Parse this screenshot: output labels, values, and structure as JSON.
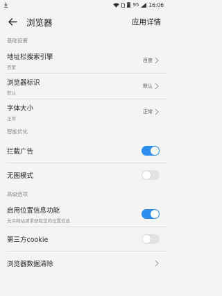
{
  "status_bar": {
    "battery_pct": "95",
    "time": "16:06"
  },
  "header": {
    "title": "浏览器",
    "action_label": "应用详情"
  },
  "sections": {
    "basic": {
      "header": "基础设置",
      "address_bar_engine": {
        "label": "地址栏搜索引擎",
        "sub": "百度",
        "value": "百度"
      },
      "browser_ua": {
        "label": "浏览器标识",
        "sub": "默认",
        "value": "默认"
      },
      "font_size": {
        "label": "字体大小",
        "sub": "正常",
        "value": "正常"
      }
    },
    "smart": {
      "header": "智能优化",
      "block_ads": {
        "label": "拦截广告",
        "enabled": true
      },
      "no_image": {
        "label": "无图模式",
        "enabled": false
      }
    },
    "advanced": {
      "header": "高级选项",
      "location": {
        "label": "启用位置信息功能",
        "sub": "允许网站请求获取您的位置信息",
        "enabled": true
      },
      "third_party_cookie": {
        "label": "第三方cookie",
        "enabled": false
      },
      "clear_data": {
        "label": "浏览器数据清除"
      }
    }
  },
  "colors": {
    "background": "#f4f4f4",
    "toggle_on": "#2c8ff0",
    "toggle_off": "#e2e2e2",
    "section_header": "#8a8a8a"
  }
}
